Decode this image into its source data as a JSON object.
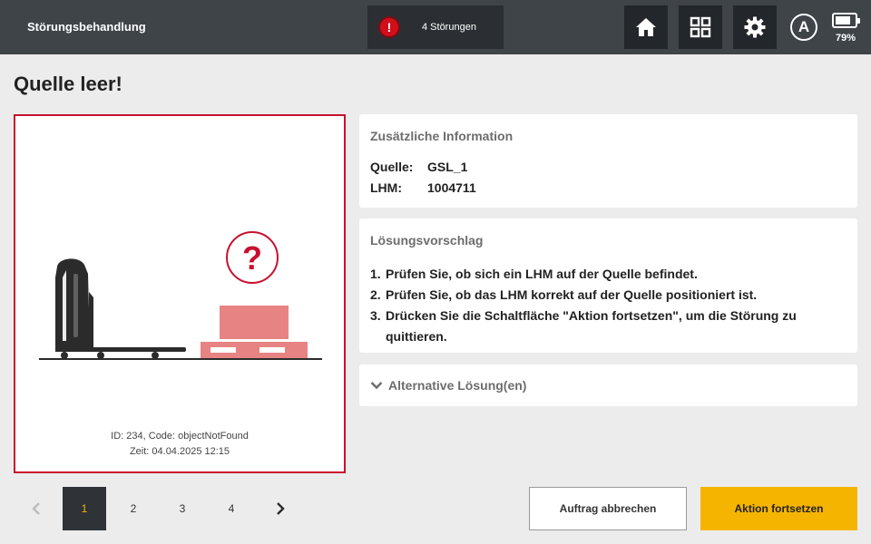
{
  "header": {
    "title": "Störungsbehandlung",
    "fault_count_label": "4 Störungen",
    "fault_icon_symbol": "!",
    "auto_mode_letter": "A",
    "battery_label": "79%",
    "battery_level": 0.79,
    "icons": [
      "alert-icon",
      "home-icon",
      "grid-icon",
      "gear-icon",
      "auto-mode-icon",
      "battery-icon"
    ]
  },
  "page": {
    "title": "Quelle leer!"
  },
  "illustration": {
    "question_mark": "?",
    "meta_id": "ID: 234, Code: objectNotFound",
    "meta_time": "Zeit: 04.04.2025 12:15"
  },
  "info": {
    "heading": "Zusätzliche Information",
    "rows": [
      {
        "key": "Quelle:",
        "value": "GSL_1"
      },
      {
        "key": "LHM:",
        "value": "1004711"
      }
    ]
  },
  "solution": {
    "heading": "Lösungsvorschlag",
    "steps": [
      {
        "num": "1.",
        "text": "Prüfen Sie, ob sich ein LHM auf der Quelle befindet."
      },
      {
        "num": "2.",
        "text": "Prüfen Sie, ob das LHM korrekt auf der Quelle positioniert ist."
      },
      {
        "num": "3.",
        "text": "Drücken Sie die Schaltfläche \"Aktion fortsetzen\", um die Störung zu quittieren."
      }
    ]
  },
  "alternative": {
    "label": "Alternative Lösung(en)"
  },
  "pagination": {
    "pages": [
      "1",
      "2",
      "3",
      "4"
    ],
    "current": "1"
  },
  "actions": {
    "cancel_label": "Auftrag abbrechen",
    "continue_label": "Aktion fortsetzen"
  },
  "colors": {
    "topbar": "#3f4449",
    "accent": "#f5b400",
    "alert": "#d10f1a",
    "panel_border": "#c8102e",
    "pallet": "#e78383"
  }
}
